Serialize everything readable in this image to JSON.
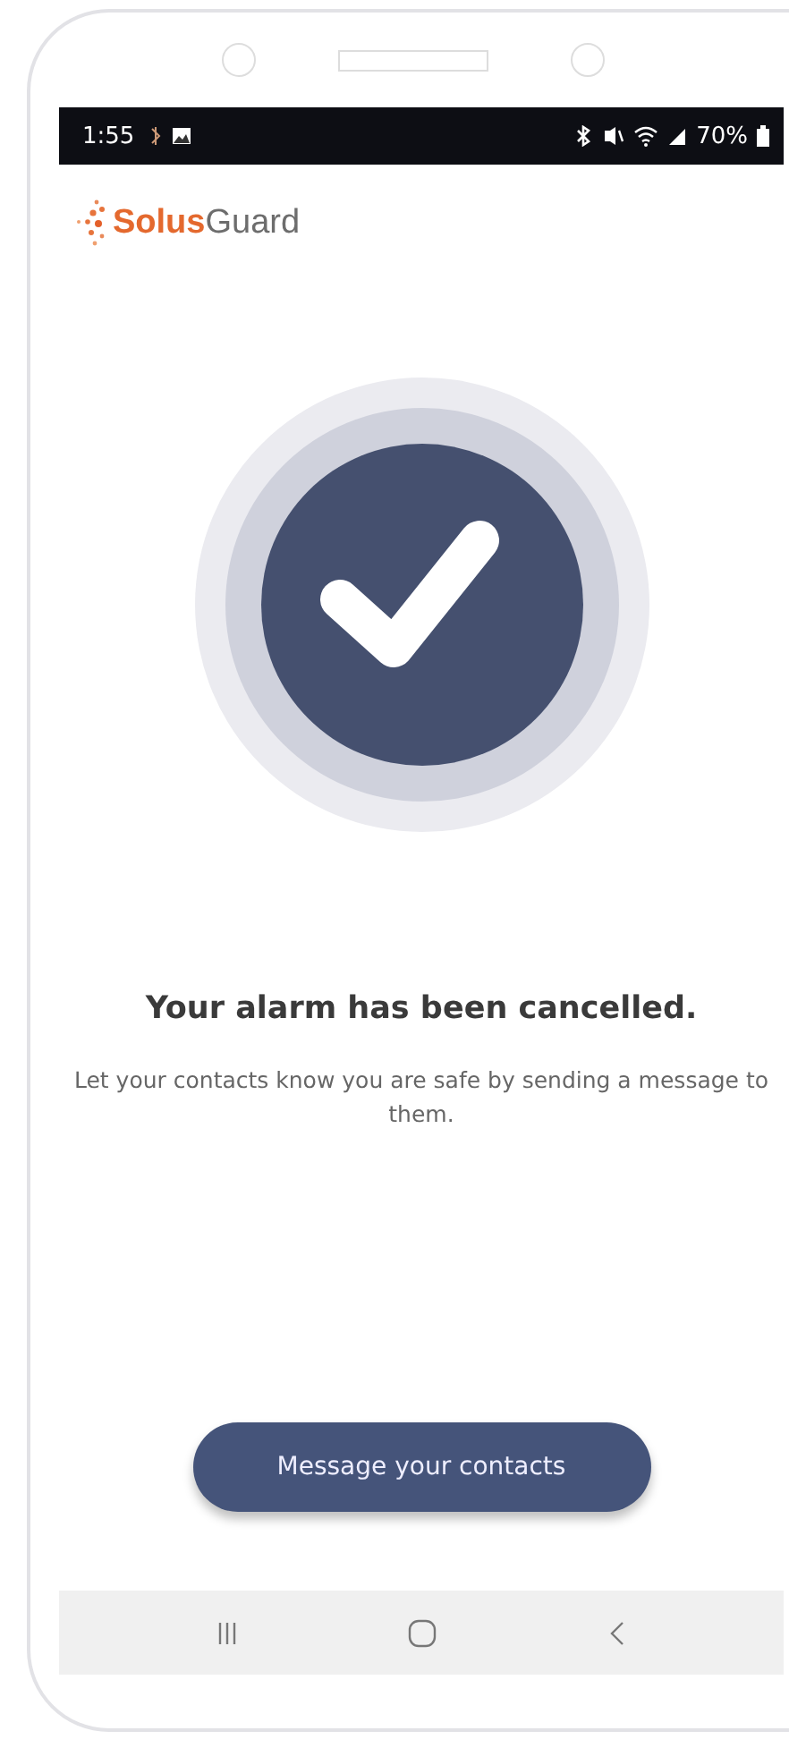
{
  "status_bar": {
    "time": "1:55",
    "battery": "70%"
  },
  "logo": {
    "bold_part": "Solus",
    "light_part": "Guard"
  },
  "title": "Your alarm has been cancelled.",
  "message": "Let your contacts know you are safe by sending a message to them.",
  "button": "Message your contacts"
}
